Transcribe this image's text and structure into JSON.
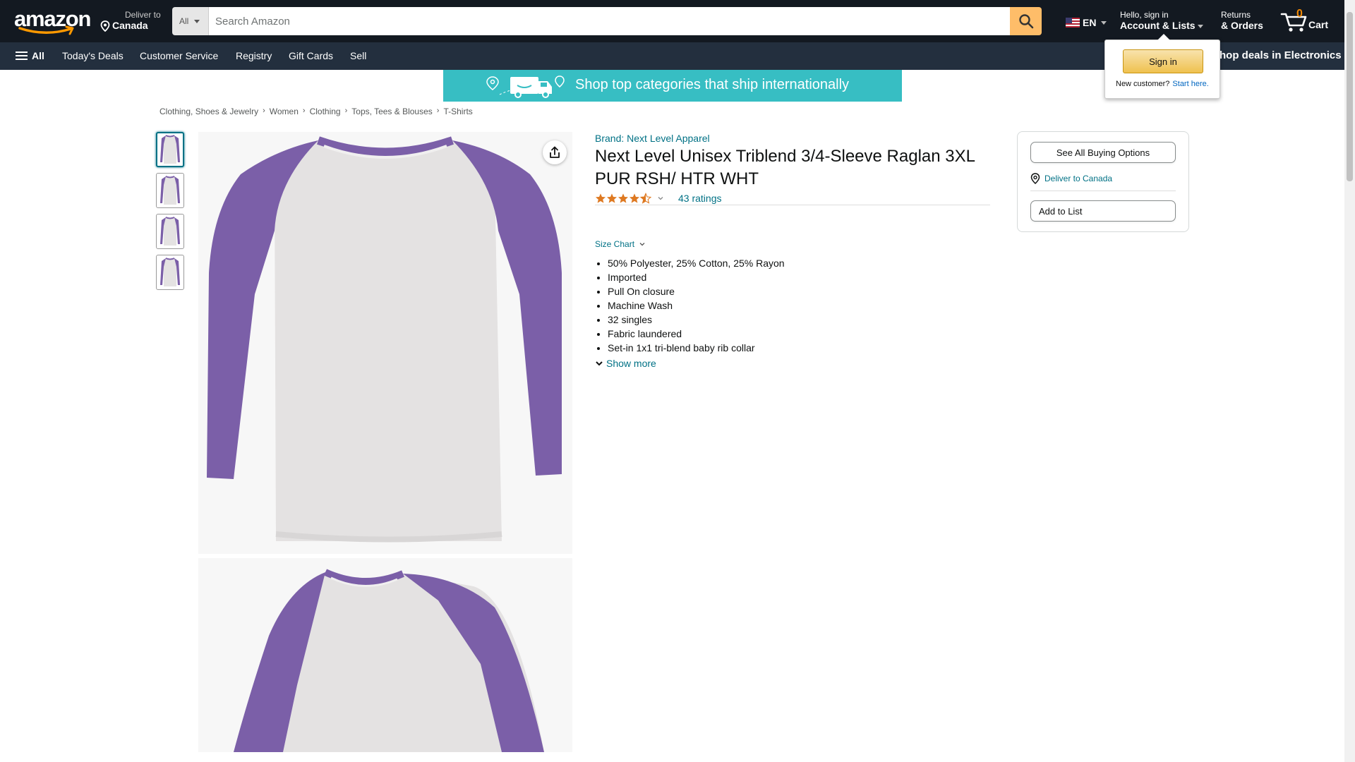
{
  "header": {
    "logo_text": "amazon",
    "deliver_line1": "Deliver to",
    "deliver_line2": "Canada",
    "search_category": "All",
    "search_placeholder": "Search Amazon",
    "language": "EN",
    "account_line1": "Hello, sign in",
    "account_line2": "Account & Lists",
    "returns_line1": "Returns",
    "returns_line2": "& Orders",
    "cart_count": "0",
    "cart_label": "Cart"
  },
  "subnav": {
    "all_label": "All",
    "items": [
      "Today's Deals",
      "Customer Service",
      "Registry",
      "Gift Cards",
      "Sell"
    ],
    "promo": "Shop deals in Electronics"
  },
  "signin_flyout": {
    "button": "Sign in",
    "new_customer": "New customer?",
    "start_here": "Start here."
  },
  "banner": {
    "text": "Shop top categories that ship internationally",
    "color": "#37bec3"
  },
  "breadcrumb": [
    "Clothing, Shoes & Jewelry",
    "Women",
    "Clothing",
    "Tops, Tees & Blouses",
    "T-Shirts"
  ],
  "product": {
    "brand": "Brand: Next Level Apparel",
    "title": "Next Level Unisex Triblend 3/4-Sleeve Raglan 3XL PUR RSH/ HTR WHT",
    "rating_stars": 4.5,
    "ratings_count": "43 ratings",
    "size_chart": "Size Chart",
    "bullets": [
      "50% Polyester, 25% Cotton, 25% Rayon",
      "Imported",
      "Pull On closure",
      "Machine Wash",
      "32 singles",
      "Fabric laundered",
      "Set-in 1x1 tri-blend baby rib collar"
    ],
    "show_more": "Show more",
    "sleeve_color": "#7b5fa8",
    "body_color": "#e4e2e2"
  },
  "buybox": {
    "see_all": "See All Buying Options",
    "deliver": "Deliver to Canada",
    "add_to_list": "Add to List"
  },
  "colors": {
    "nav_dark": "#131921",
    "nav_sub": "#232f3e",
    "search_button": "#febd69",
    "link": "#007185",
    "star": "#de7921"
  }
}
